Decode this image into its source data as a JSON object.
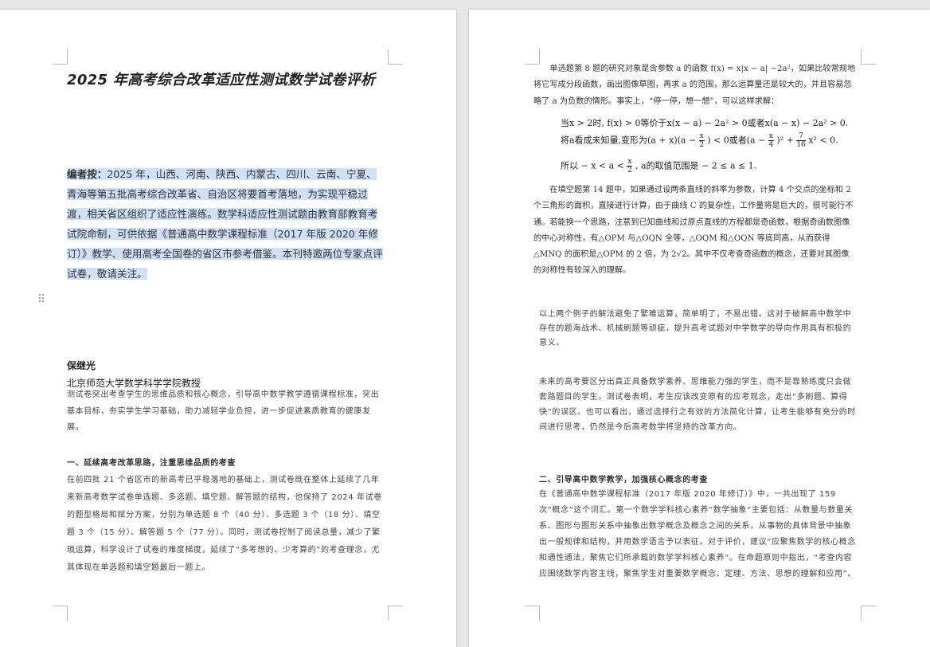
{
  "title": "2025 年高考综合改革适应性测试数学试卷评析",
  "editor_note": {
    "label": "编者按：",
    "text": "2025 年，山西、河南、陕西、内蒙古、四川、云南、宁夏、青海等第五批高考综合改革省、自治区将要首考落地，为实现平稳过渡，相关省区组织了适应性演练。数学科适应性测试题由教育部教育考试院命制，可供依据《普通高中数学课程标准（2017 年版 2020 年修订）》教学、使用高考全国卷的省区市参考借鉴。本刊特邀两位专家点评试卷，敬请关注。"
  },
  "author": {
    "name": "保继光",
    "affiliation": "北京师范大学数学科学学院教授"
  },
  "intro": "测试卷突出考查学生的思维品质和核心概念，引导高中数学教学遵循课程标准，突出基本目标，夯实学生学习基础，助力减轻学业负担，进一步促进素质教育的健康发展。",
  "section1": {
    "heading": "一、延续高考改革思路，注重思维品质的考查",
    "text": "在前四批 21 个省区市的新高考已平稳落地的基础上，测试卷既在整体上延续了几年来新高考数学试卷单选题、多选题、填空题、解答题的结构，也保持了 2024 年试卷的题型格局和赋分方案，分别为单选题 8 个（40 分）、多选题 3 个（18 分）、填空题 3 个（15 分）、解答题 5 个（77 分）。同时，测试卷控制了阅读总量，减少了繁琐运算，科学设计了试卷的难度梯度，延续了“多考想的、少考算的”的考查理念，尤其体现在单选题和填空题最后一题上。"
  },
  "right": {
    "p1": "单选题第 8 题的研究对象是含参数 a 的函数 f(x) = x|x − a| −2a²，如果比较常规地将它写成分段函数，画出图像草图，再求 a 的范围，那么运算量还是较大的，并且容易忽略了 a 为负数的情形。事实上，“停一停，想一想”，可以这样求解：",
    "m1": "当x > 2时, f(x) > 0等价于x(x − a) − 2a² > 0或者x(a − x) − 2a² > 0.",
    "m2a": "将a看成未知量,变形为(a + x)(a −",
    "m2b": ") < 0或者(a −",
    "m2c": ")² +",
    "m2d": "x² < 0.",
    "m3a": "所以 − x < a <",
    "m3b": ", a的取值范围是 − 2 ≤ a ≤ 1.",
    "frac_x2_num": "x",
    "frac_x2_den": "2",
    "frac_x4_num": "x",
    "frac_x4_den": "4",
    "frac_716_num": "7",
    "frac_716_den": "16",
    "p2": "在填空题第 14 题中，如果通过设两条直线的斜率为参数，计算 4 个交点的坐标和 2 个三角形的面积，直接进行计算，由于曲线 C 的复杂性，工作量将是巨大的，很可能行不通。若能换一个思路，注意到已知曲线和过原点直线的方程都是奇函数，根据奇函数图像的中心对称性，有△OPM 与△OQN 全等，△OQM 和△OQN 等底同高，从而获得△MNQ 的面积是△OPM 的 2 倍，为 2√2。其中不仅考查奇函数的概念，还要对其图像的对称性有较深入的理解。",
    "p3": "以上两个例子的解法避免了繁难运算，简单明了，不易出错。这对于破解高中数学中存在的题海战术、机械刷题等顽疵，提升高考试题对中学数学的导向作用具有积极的意义。",
    "p4": "未来的高考要区分出真正具备数学素养、思维能力强的学生，而不是靠熟练度只会做套路题目的学生。测试卷表明，考生应该改变原有的应考观念，走出“多刷题、算得快”的误区。也可以看出，通过选择行之有效的方法简化计算，让考生能够有充分的时间进行思考，仍然是今后高考数学将坚持的改革方向。",
    "section2_heading": "二、引导高中数学教学，加强核心概念的考查",
    "p5": "在《普通高中数学课程标准（2017 年版 2020 年修订）》中，一共出现了 159 次“概念”这个词汇。第一个数学学科核心素养“数学抽象”主要包括：从数量与数量关系、图形与图形关系中抽象出数学概念及概念之间的关系，从事物的具体背景中抽象出一般规律和结构，并用数学语言予以表征。对于评价，建议“应聚焦数学的核心概念和通性通法，聚焦它们所承载的数学学科核心素养”。在命题原则中指出，“考查内容应围绕数学内容主线，聚焦学生对重要数学概念、定理、方法、思想的理解和应用”。"
  }
}
